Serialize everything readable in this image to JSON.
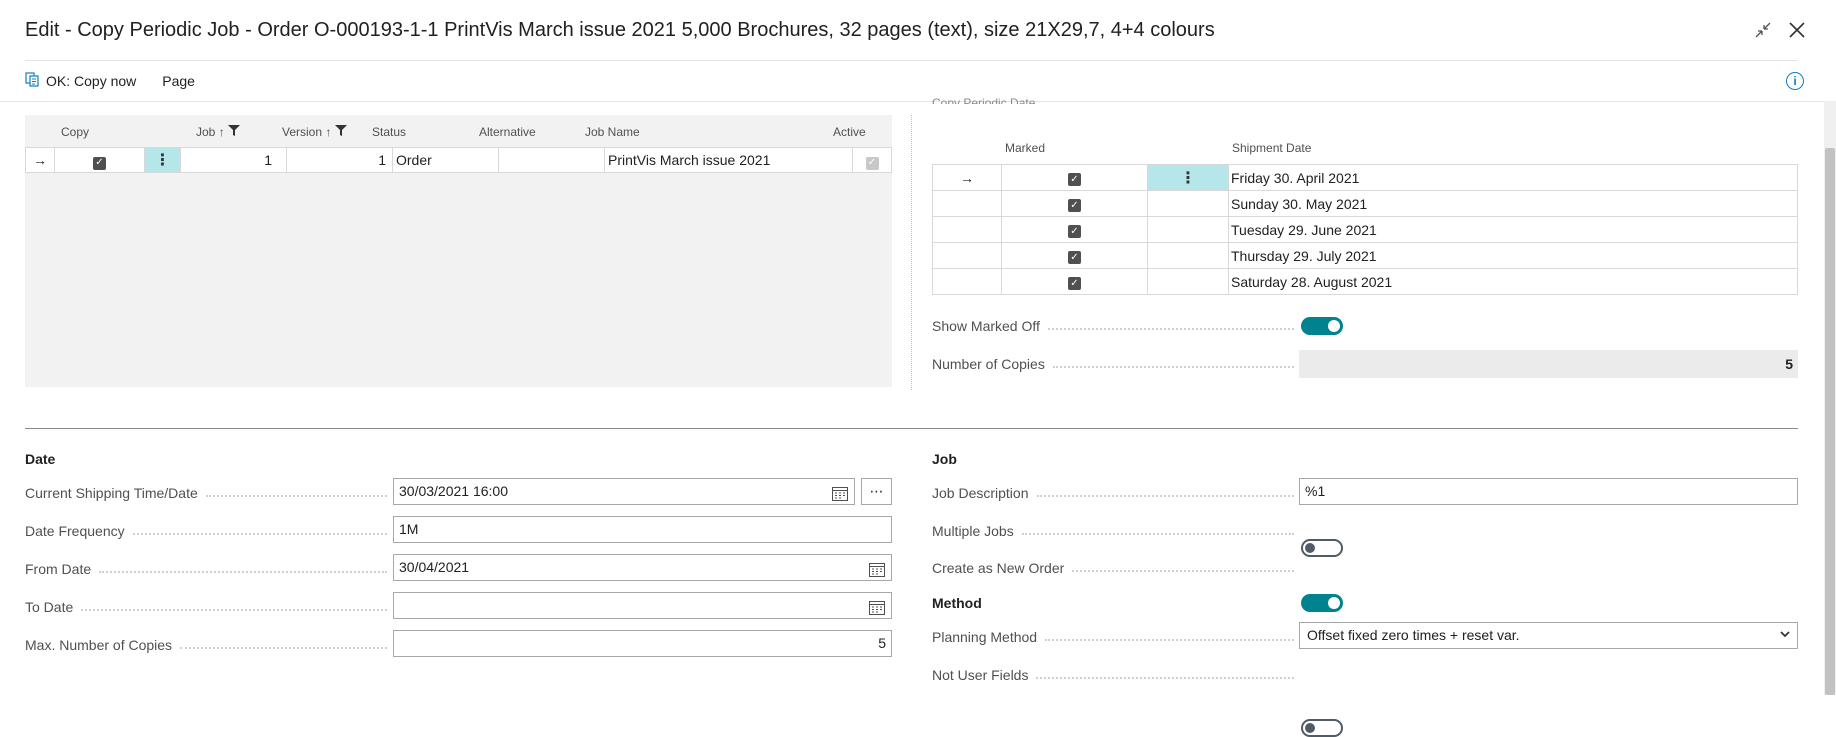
{
  "window": {
    "title": "Edit - Copy Periodic Job - Order O-000193-1-1 PrintVis March issue 2021 5,000 Brochures, 32 pages (text), size 21X29,7, 4+4 colours"
  },
  "actions": {
    "ok_copy": "OK: Copy now",
    "page": "Page"
  },
  "job_grid": {
    "headers": {
      "copy": "Copy",
      "job": "Job",
      "version": "Version",
      "status": "Status",
      "alternative": "Alternative",
      "job_name": "Job Name",
      "active": "Active"
    },
    "row": {
      "job": "1",
      "version": "1",
      "status": "Order",
      "alternative": "",
      "job_name": "PrintVis March issue 2021"
    }
  },
  "copy_periodic": {
    "section_partial": "Copy Periodic Date",
    "headers": {
      "marked": "Marked",
      "shipment_date": "Shipment Date"
    },
    "rows": [
      {
        "date": "Friday 30. April 2021"
      },
      {
        "date": "Sunday 30. May 2021"
      },
      {
        "date": "Tuesday 29. June 2021"
      },
      {
        "date": "Thursday 29. July 2021"
      },
      {
        "date": "Saturday 28. August 2021"
      }
    ],
    "show_marked_off_label": "Show Marked Off",
    "number_of_copies_label": "Number of Copies",
    "number_of_copies": "5"
  },
  "date_section": {
    "title": "Date",
    "current_shipping_label": "Current Shipping Time/Date",
    "current_shipping_value": "30/03/2021 16:00",
    "date_frequency_label": "Date Frequency",
    "date_frequency_value": "1M",
    "from_date_label": "From Date",
    "from_date_value": "30/04/2021",
    "to_date_label": "To Date",
    "to_date_value": "",
    "max_copies_label": "Max. Number of Copies",
    "max_copies_value": "5"
  },
  "job_section": {
    "title": "Job",
    "job_description_label": "Job Description",
    "job_description_value": "%1",
    "multiple_jobs_label": "Multiple Jobs",
    "create_new_order_label": "Create as New Order"
  },
  "method_section": {
    "title": "Method",
    "planning_method_label": "Planning Method",
    "planning_method_value": "Offset fixed zero times + reset var.",
    "not_user_fields_label": "Not User Fields"
  },
  "colors": {
    "accent": "#00838f",
    "selected_cell": "#b5e6ea",
    "link": "#0e7fc2"
  }
}
